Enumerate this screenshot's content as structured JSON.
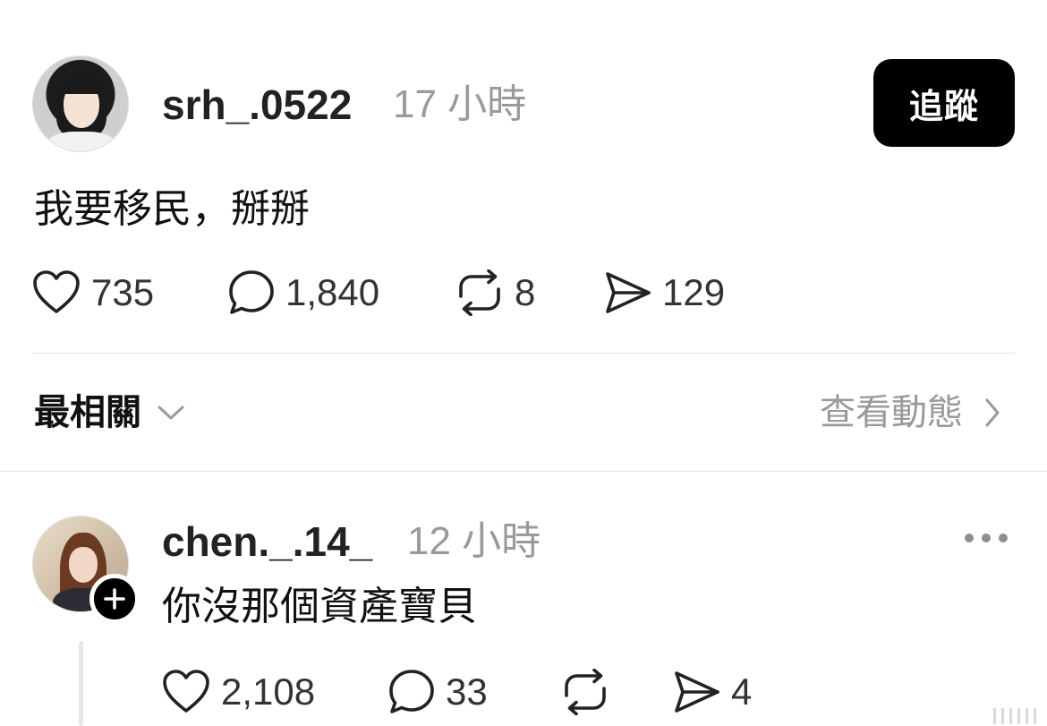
{
  "post": {
    "username": "srh_.0522",
    "timestamp": "17 小時",
    "follow_label": "追蹤",
    "text": "我要移民，掰掰",
    "likes": "735",
    "comments": "1,840",
    "reposts": "8",
    "shares": "129"
  },
  "replies_header": {
    "sort_label": "最相關",
    "activity_label": "查看動態"
  },
  "reply": {
    "username": "chen._.14_",
    "timestamp": "12 小時",
    "text": "你沒那個資產寶貝",
    "likes": "2,108",
    "comments": "33",
    "shares": "4"
  },
  "icons": {
    "like": "heart-icon",
    "comment": "comment-bubble-icon",
    "repost": "repost-icon",
    "share": "send-icon",
    "sort": "chevron-down-icon",
    "activity": "chevron-right-icon",
    "more": "more-horizontal-icon",
    "follow_badge": "plus-icon"
  },
  "colors": {
    "text_primary": "#222222",
    "text_secondary": "#9a9a9a",
    "button_bg": "#000000",
    "button_text": "#ffffff",
    "divider": "#e2e2e2"
  }
}
